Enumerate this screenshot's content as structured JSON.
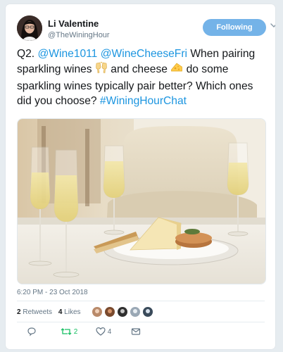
{
  "user": {
    "display_name": "Li Valentine",
    "handle": "@TheWiningHour",
    "follow_label": "Following"
  },
  "tweet": {
    "text_prefix": "Q2. ",
    "mention_1": "@Wine1011",
    "mention_2": "@WineCheeseFri",
    "text_part_1": " When pairing sparkling wines ",
    "emoji_1": "clinking-glasses-emoji",
    "text_part_2": " and cheese ",
    "emoji_2": "cheese-emoji",
    "text_part_3": " do some sparkling wines typically pair better? Which ones did you choose? ",
    "hashtag": "#WiningHourChat",
    "timestamp": "6:20 PM - 23 Oct 2018"
  },
  "stats": {
    "retweets_count": "2",
    "retweets_label": "Retweets",
    "likes_count": "4",
    "likes_label": "Likes"
  },
  "actions": {
    "reply_count": "",
    "retweet_count": "2",
    "like_count": "4"
  },
  "colors": {
    "link": "#1b95e0",
    "follow_button": "#74b3e8",
    "retweet_green": "#17bf63",
    "muted_text": "#657786"
  }
}
